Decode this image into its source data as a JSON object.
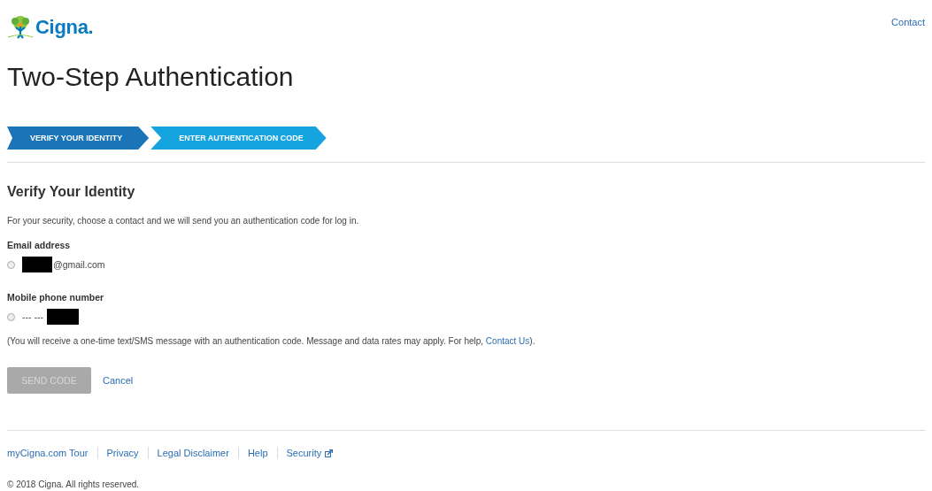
{
  "header": {
    "brand": "Cigna.",
    "contact_link": "Contact"
  },
  "title": "Two-Step Authentication",
  "steps": [
    {
      "label": "VERIFY YOUR IDENTITY",
      "selected": true
    },
    {
      "label": "ENTER AUTHENTICATION CODE",
      "selected": false
    }
  ],
  "section": {
    "heading": "Verify Your Identity",
    "intro": "For your security, choose a contact and we will send you an authentication code for log in.",
    "options": [
      {
        "label": "Email address",
        "kind": "email",
        "value": "@gmail.com",
        "selected": false
      },
      {
        "label": "Mobile phone number",
        "kind": "phone",
        "prefix": "--- ---",
        "selected": false
      }
    ],
    "note": "(You will receive a one-time text/SMS message with an authentication code. Message and data rates may apply. For help, ",
    "note_link": "Contact Us",
    "note_end": ")."
  },
  "actions": {
    "primary": {
      "label": "SEND CODE",
      "disabled": true
    },
    "secondary": "Cancel"
  },
  "footer": {
    "links": [
      {
        "label": "myCigna.com Tour",
        "external": false
      },
      {
        "label": "Privacy",
        "external": false
      },
      {
        "label": "Legal Disclaimer",
        "external": false
      },
      {
        "label": "Help",
        "external": false
      },
      {
        "label": "Security",
        "external": true
      }
    ],
    "copyright": "© 2018 Cigna. All rights reserved."
  }
}
